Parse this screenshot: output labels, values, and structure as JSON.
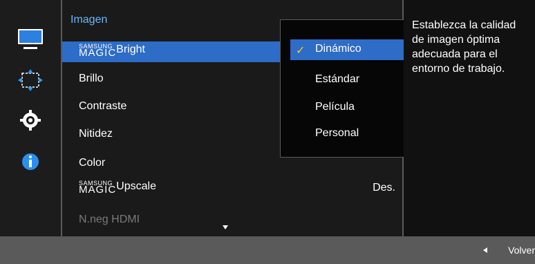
{
  "menu": {
    "title": "Imagen",
    "items": [
      {
        "label": "Bright",
        "brand": {
          "line1": "SAMSUNG",
          "line2": "MAGIC"
        },
        "value": ""
      },
      {
        "label": "Brillo",
        "value": ""
      },
      {
        "label": "Contraste",
        "value": ""
      },
      {
        "label": "Nitidez",
        "value": ""
      },
      {
        "label": "Color",
        "value": ""
      },
      {
        "label": "Upscale",
        "brand": {
          "line1": "SAMSUNG",
          "line2": "MAGIC"
        },
        "value": "Des."
      },
      {
        "label": "N.neg HDMI",
        "value": ""
      }
    ]
  },
  "submenu": {
    "options": [
      {
        "label": "Dinámico",
        "check": "✓"
      },
      {
        "label": "Estándar",
        "check": ""
      },
      {
        "label": "Película",
        "check": ""
      },
      {
        "label": "Personal",
        "check": ""
      }
    ]
  },
  "help": {
    "text": "Establezca la calidad de imagen óptima adecuada para el entorno de trabajo."
  },
  "footer": {
    "back_label": "Volver"
  },
  "icons": {
    "picture": "monitor-icon",
    "position": "arrows-icon",
    "settings": "gear-icon",
    "info": "info-icon"
  },
  "colors": {
    "accent": "#2d6cc7",
    "title": "#6bb8ff",
    "check": "#f4d02c"
  }
}
